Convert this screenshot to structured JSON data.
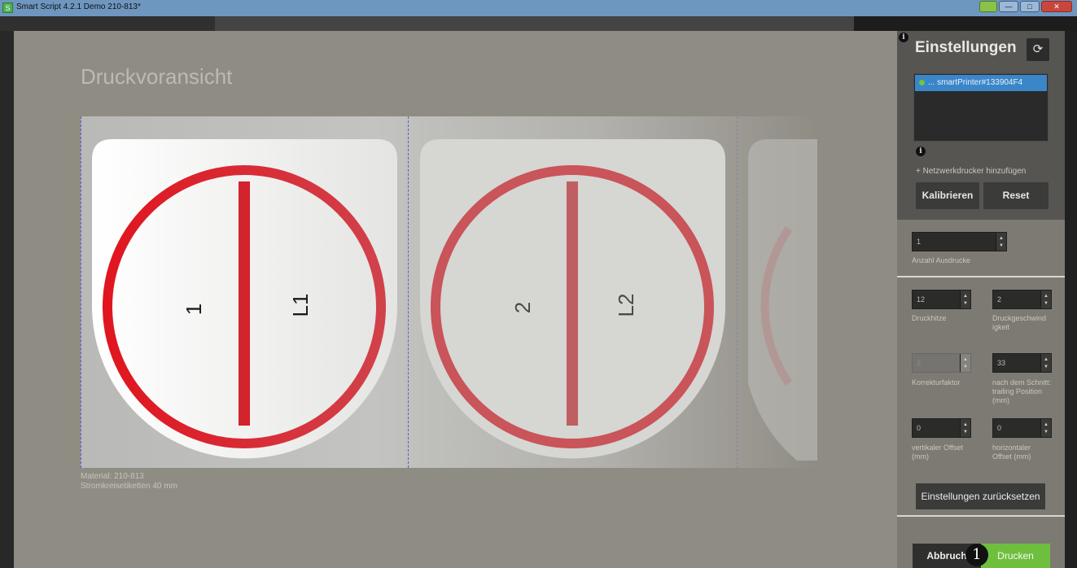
{
  "window": {
    "title": "Smart Script 4.2.1  Demo 210-813*",
    "app_icon_glyph": "S"
  },
  "dialog": {
    "title": "Druckvoransicht",
    "material_line1": "Material: 210-813",
    "material_line2": "Stromkreisetiketten 40 mm"
  },
  "labels": [
    {
      "left_text": "1",
      "right_text": "L1",
      "ring_color": "#d81e2a"
    },
    {
      "left_text": "2",
      "right_text": "L2",
      "ring_color": "#c65b60"
    }
  ],
  "settings": {
    "title": "Einstellungen",
    "refresh_icon": "refresh-icon",
    "printer_selected": "... smartPrinter#133904F4",
    "add_network_printer": "+ Netzwerkdrucker hinzufügen",
    "calibrate_label": "Kalibrieren",
    "reset_label": "Reset",
    "copies": {
      "value": "1",
      "label": "Anzahl Ausdrucke"
    },
    "heat": {
      "value": "12",
      "label": "Druckhitze"
    },
    "speed": {
      "value": "2",
      "label": "Druckgeschwind igkeit"
    },
    "correction": {
      "value": "3",
      "label": "Korrekturfaktor"
    },
    "trailing": {
      "value": "33",
      "label": "nach dem Schnitt: trailing Position (mm)"
    },
    "v_offset": {
      "value": "0",
      "label": "vertikaler Offset (mm)"
    },
    "h_offset": {
      "value": "0",
      "label": "horizontaler Offset (mm)"
    },
    "reset_settings_label": "Einstellungen zurücksetzen",
    "cancel_label": "Abbruch",
    "print_label": "Drucken",
    "step_badge": "1"
  },
  "colors": {
    "accent_blue": "#3a86c8",
    "print_green": "#6fbf3e",
    "label_red": "#d81e2a"
  }
}
